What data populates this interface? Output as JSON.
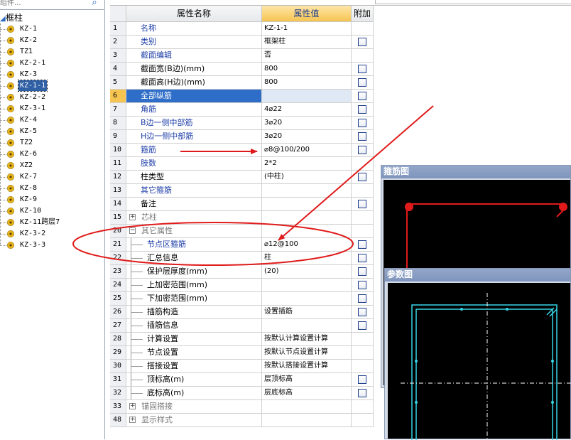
{
  "search": {
    "placeholder": "组件..."
  },
  "tree": {
    "root_label": "框柱",
    "items": [
      {
        "label": "KZ-1"
      },
      {
        "label": "KZ-2"
      },
      {
        "label": "TZ1"
      },
      {
        "label": "KZ-2-1"
      },
      {
        "label": "KZ-3"
      },
      {
        "label": "KZ-1-1",
        "selected": true
      },
      {
        "label": "KZ-2-2"
      },
      {
        "label": "KZ-3-1"
      },
      {
        "label": "KZ-4"
      },
      {
        "label": "KZ-5"
      },
      {
        "label": "TZ2"
      },
      {
        "label": "KZ-6"
      },
      {
        "label": "XZ2"
      },
      {
        "label": "KZ-7"
      },
      {
        "label": "KZ-8"
      },
      {
        "label": "KZ-9"
      },
      {
        "label": "KZ-10"
      },
      {
        "label": "KZ-11跨层7"
      },
      {
        "label": "KZ-3-2"
      },
      {
        "label": "KZ-3-3"
      }
    ]
  },
  "grid": {
    "header": {
      "name": "属性名称",
      "value": "属性值",
      "attach": "附加"
    },
    "rows": [
      {
        "num": "1",
        "name": "名称",
        "value": "KZ-1-1",
        "blue": true,
        "check": false
      },
      {
        "num": "2",
        "name": "类别",
        "value": "框架柱",
        "blue": true,
        "check": true
      },
      {
        "num": "3",
        "name": "截面编辑",
        "value": "否",
        "blue": true,
        "check": false
      },
      {
        "num": "4",
        "name": "截面宽(B边)(mm)",
        "value": "800",
        "blue": false,
        "check": true
      },
      {
        "num": "5",
        "name": "截面高(H边)(mm)",
        "value": "800",
        "blue": false,
        "check": true
      },
      {
        "num": "6",
        "name": "全部纵筋",
        "value": "",
        "blue": true,
        "check": true,
        "highlight": true
      },
      {
        "num": "7",
        "name": "角筋",
        "value": "4⌀22",
        "blue": true,
        "check": true
      },
      {
        "num": "8",
        "name": "B边一侧中部筋",
        "value": "3⌀20",
        "blue": true,
        "check": true
      },
      {
        "num": "9",
        "name": "H边一侧中部筋",
        "value": "3⌀20",
        "blue": true,
        "check": true
      },
      {
        "num": "10",
        "name": "箍筋",
        "value": "⌀8@100/200",
        "blue": true,
        "check": true
      },
      {
        "num": "11",
        "name": "肢数",
        "value": "2*2",
        "blue": true,
        "check": false
      },
      {
        "num": "12",
        "name": "柱类型",
        "value": "(中柱)",
        "blue": false,
        "check": true
      },
      {
        "num": "13",
        "name": "其它箍筋",
        "value": "",
        "blue": true,
        "check": false
      },
      {
        "num": "14",
        "name": "备注",
        "value": "",
        "blue": false,
        "check": true
      },
      {
        "num": "15",
        "name": "芯柱",
        "value": "",
        "group": true,
        "expander": "+",
        "check": false
      },
      {
        "num": "20",
        "name": "其它属性",
        "value": "",
        "group": true,
        "expander": "−",
        "check": false
      },
      {
        "num": "21",
        "name": "节点区箍筋",
        "value": "⌀12@100",
        "blue": true,
        "sub": true,
        "check": true
      },
      {
        "num": "22",
        "name": "汇总信息",
        "value": "柱",
        "blue": false,
        "sub": true,
        "check": true
      },
      {
        "num": "23",
        "name": "保护层厚度(mm)",
        "value": "(20)",
        "blue": false,
        "sub": true,
        "check": true
      },
      {
        "num": "24",
        "name": "上加密范围(mm)",
        "value": "",
        "blue": false,
        "sub": true,
        "check": true
      },
      {
        "num": "25",
        "name": "下加密范围(mm)",
        "value": "",
        "blue": false,
        "sub": true,
        "check": true
      },
      {
        "num": "26",
        "name": "插筋构造",
        "value": "设置插筋",
        "blue": false,
        "sub": true,
        "check": true
      },
      {
        "num": "27",
        "name": "插筋信息",
        "value": "",
        "blue": false,
        "sub": true,
        "check": true
      },
      {
        "num": "28",
        "name": "计算设置",
        "value": "按默认计算设置计算",
        "blue": false,
        "sub": true,
        "check": false
      },
      {
        "num": "29",
        "name": "节点设置",
        "value": "按默认节点设置计算",
        "blue": false,
        "sub": true,
        "check": false
      },
      {
        "num": "30",
        "name": "搭接设置",
        "value": "按默认搭接设置计算",
        "blue": false,
        "sub": true,
        "check": false
      },
      {
        "num": "31",
        "name": "顶标高(m)",
        "value": "层顶标高",
        "blue": false,
        "sub": true,
        "check": true
      },
      {
        "num": "32",
        "name": "底标高(m)",
        "value": "层底标高",
        "blue": false,
        "sub": true,
        "check": true
      },
      {
        "num": "33",
        "name": "锚固搭接",
        "value": "",
        "group": true,
        "expander": "+",
        "check": false
      },
      {
        "num": "48",
        "name": "显示样式",
        "value": "",
        "group": true,
        "expander": "+",
        "check": false
      }
    ]
  },
  "windows": {
    "stirrup": {
      "title": "箍筋图"
    },
    "params": {
      "title": "参数图"
    }
  },
  "colors": {
    "highlight_row": "#2f6ec8",
    "header_value_bg": "#f5c451",
    "annotation_red": "#e01a1a",
    "drawing_cyan": "#36d6e8"
  }
}
